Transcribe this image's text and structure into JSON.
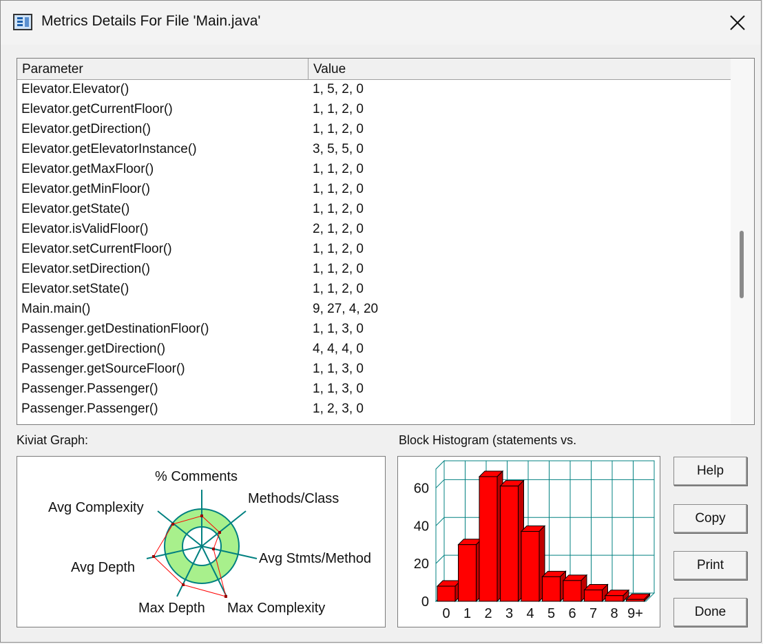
{
  "window": {
    "title": "Metrics Details For File 'Main.java'"
  },
  "table": {
    "columns": [
      "Parameter",
      "Value"
    ],
    "rows": [
      [
        "Elevator.Elevator()",
        "1, 5, 2, 0"
      ],
      [
        "Elevator.getCurrentFloor()",
        "1, 1, 2, 0"
      ],
      [
        "Elevator.getDirection()",
        "1, 1, 2, 0"
      ],
      [
        "Elevator.getElevatorInstance()",
        "3, 5, 5, 0"
      ],
      [
        "Elevator.getMaxFloor()",
        "1, 1, 2, 0"
      ],
      [
        "Elevator.getMinFloor()",
        "1, 1, 2, 0"
      ],
      [
        "Elevator.getState()",
        "1, 1, 2, 0"
      ],
      [
        "Elevator.isValidFloor()",
        "2, 1, 2, 0"
      ],
      [
        "Elevator.setCurrentFloor()",
        "1, 1, 2, 0"
      ],
      [
        "Elevator.setDirection()",
        "1, 1, 2, 0"
      ],
      [
        "Elevator.setState()",
        "1, 1, 2, 0"
      ],
      [
        "Main.main()",
        "9, 27, 4, 20"
      ],
      [
        "Passenger.getDestinationFloor()",
        "1, 1, 3, 0"
      ],
      [
        "Passenger.getDirection()",
        "4, 4, 4, 0"
      ],
      [
        "Passenger.getSourceFloor()",
        "1, 1, 3, 0"
      ],
      [
        "Passenger.Passenger()",
        "1, 1, 3, 0"
      ],
      [
        "Passenger.Passenger()",
        "1, 2, 3, 0"
      ]
    ]
  },
  "kiviat": {
    "title": "Kiviat Graph:",
    "axes": [
      "% Comments",
      "Methods/Class",
      "Avg Stmts/Method",
      "Max Complexity",
      "Max Depth",
      "Avg Depth",
      "Avg Complexity"
    ]
  },
  "histogram": {
    "title": "Block Histogram (statements vs."
  },
  "chart_data": {
    "type": "bar",
    "title": "Block Histogram (statements vs.",
    "categories": [
      "0",
      "1",
      "2",
      "3",
      "4",
      "5",
      "6",
      "7",
      "8",
      "9+"
    ],
    "values": [
      8,
      30,
      66,
      61,
      37,
      13,
      11,
      6,
      3,
      1
    ],
    "ylim": [
      0,
      70
    ],
    "yticks": [
      0,
      20,
      40,
      60
    ],
    "grid": true,
    "bar_color": "#ff0000"
  },
  "buttons": {
    "help": "Help",
    "copy": "Copy",
    "print": "Print",
    "done": "Done"
  }
}
